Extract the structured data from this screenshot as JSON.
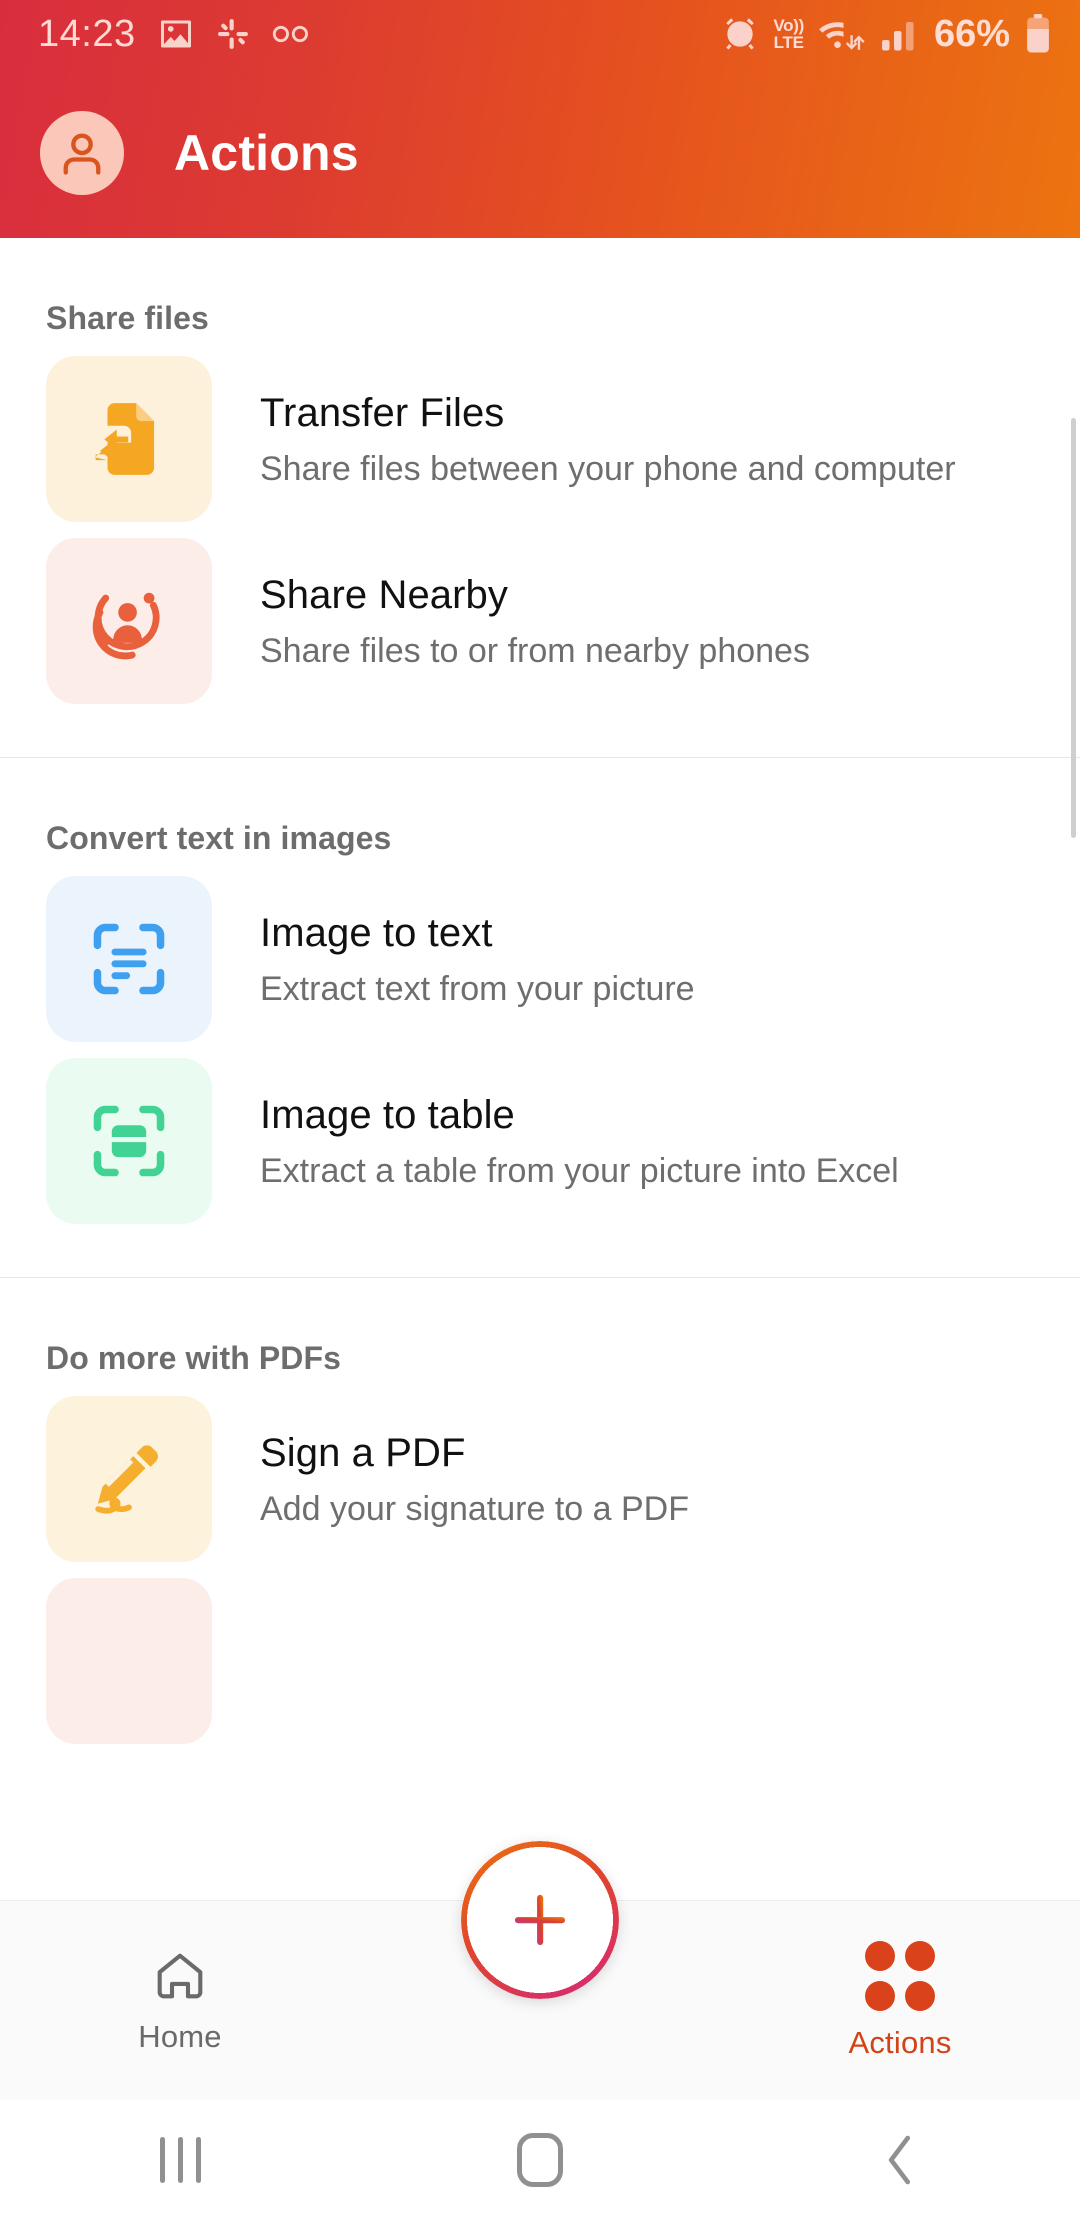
{
  "status_bar": {
    "time": "14:23",
    "left_icons": [
      "image-icon",
      "slack-icon",
      "voicemail-icon"
    ],
    "alarm_icon": "alarm-icon",
    "volte_line1": "Vo))",
    "volte_line2": "LTE",
    "wifi_icon": "wifi-icon",
    "signal_icon": "signal-bars-icon",
    "battery_percent": "66%",
    "battery_icon": "battery-icon"
  },
  "app_bar": {
    "title": "Actions",
    "avatar_icon": "account-avatar-icon"
  },
  "sections": [
    {
      "title": "Share files",
      "items": [
        {
          "title": "Transfer Files",
          "subtitle": "Share files between your phone and computer",
          "icon": "file-transfer-icon",
          "tile_color": "#FDF1DC",
          "icon_color": "#F5A623"
        },
        {
          "title": "Share Nearby",
          "subtitle": "Share files to or from nearby phones",
          "icon": "nearby-share-icon",
          "tile_color": "#FDEDE8",
          "icon_color": "#E8603C"
        }
      ]
    },
    {
      "title": "Convert text in images",
      "items": [
        {
          "title": "Image to text",
          "subtitle": "Extract text from your picture",
          "icon": "scan-text-icon",
          "tile_color": "#EBF4FD",
          "icon_color": "#3FA0F0"
        },
        {
          "title": "Image to table",
          "subtitle": "Extract a table from your picture into Excel",
          "icon": "scan-table-icon",
          "tile_color": "#EAFBF1",
          "icon_color": "#40D394"
        }
      ]
    },
    {
      "title": "Do more with PDFs",
      "items": [
        {
          "title": "Sign a PDF",
          "subtitle": "Add your signature to a PDF",
          "icon": "signature-pen-icon",
          "tile_color": "#FDF2DC",
          "icon_color": "#F5AE2E"
        }
      ]
    }
  ],
  "tab_bar": {
    "home_label": "Home",
    "home_icon": "home-icon",
    "fab_icon": "plus-icon",
    "actions_label": "Actions",
    "actions_icon": "grid-dots-icon"
  },
  "nav_bar": {
    "recents_icon": "recents-icon",
    "home_icon": "home-square-icon",
    "back_icon": "back-chevron-icon"
  },
  "colors": {
    "header_start": "#D92D3E",
    "header_end": "#EC7410",
    "accent": "#D24317"
  }
}
